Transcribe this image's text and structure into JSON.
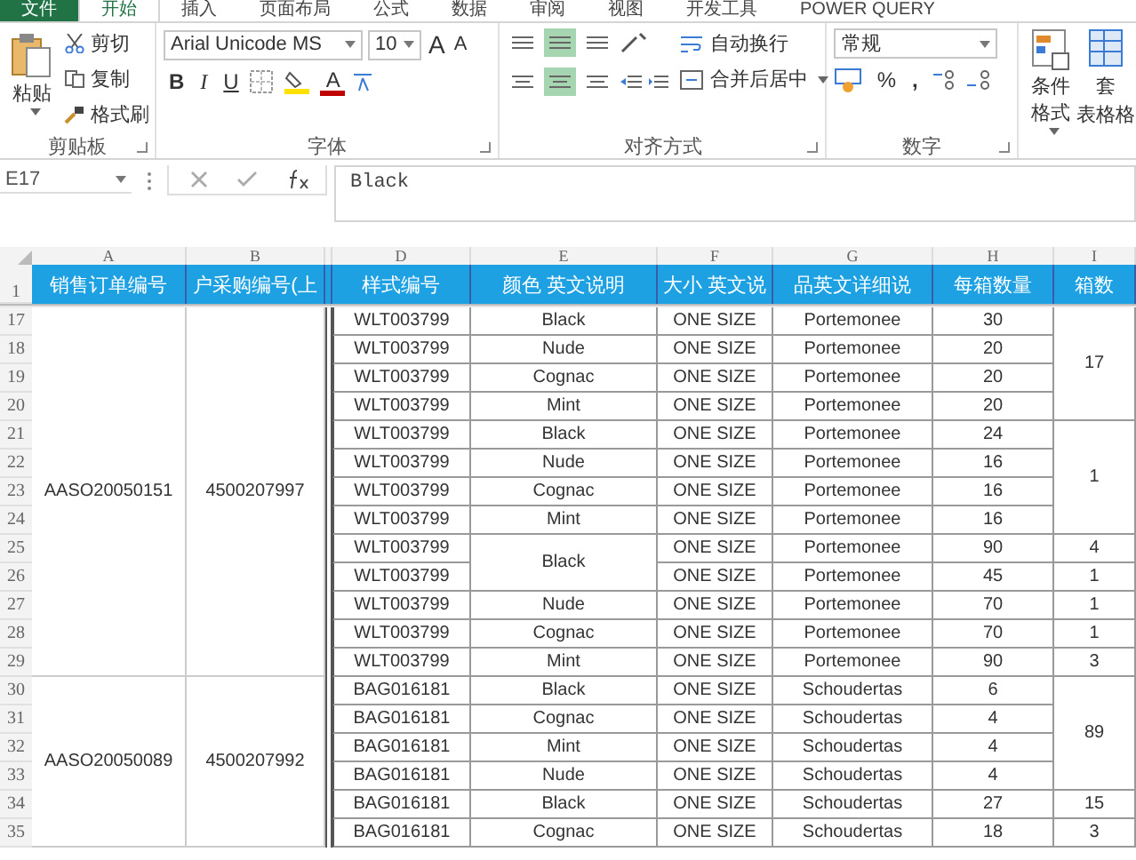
{
  "tabs": [
    {
      "label": "文件",
      "kind": "file",
      "selected": false
    },
    {
      "label": "开始",
      "kind": "tab",
      "selected": true
    },
    {
      "label": "插入",
      "kind": "tab",
      "selected": false
    },
    {
      "label": "页面布局",
      "kind": "tab",
      "selected": false
    },
    {
      "label": "公式",
      "kind": "tab",
      "selected": false
    },
    {
      "label": "数据",
      "kind": "tab",
      "selected": false
    },
    {
      "label": "审阅",
      "kind": "tab",
      "selected": false
    },
    {
      "label": "视图",
      "kind": "tab",
      "selected": false
    },
    {
      "label": "开发工具",
      "kind": "tab",
      "selected": false
    },
    {
      "label": "POWER QUERY",
      "kind": "tab",
      "selected": false
    }
  ],
  "ribbon": {
    "clipboard": {
      "label": "剪贴板",
      "paste": "粘贴",
      "cut": "剪切",
      "copy": "复制",
      "format_painter": "格式刷"
    },
    "font": {
      "label": "字体",
      "font_name": "Arial Unicode MS",
      "font_size": "10",
      "grow": "A",
      "shrink": "A",
      "bold": "B",
      "italic": "I",
      "underline": "U",
      "font_color": "A"
    },
    "alignment": {
      "label": "对齐方式",
      "vertical_align": [
        {
          "selected": false
        },
        {
          "selected": true
        },
        {
          "selected": false
        }
      ],
      "horizontal_align": [
        {
          "selected": false
        },
        {
          "selected": true
        },
        {
          "selected": false
        }
      ],
      "wrap": "自动换行",
      "merge": "合并后居中"
    },
    "number": {
      "label": "数字",
      "format": "常规",
      "percent": "%",
      "comma": ","
    },
    "styles": {
      "conditional": "条件格式",
      "table_format_top": "套",
      "table_format_bottom": "表格格"
    }
  },
  "formula_bar": {
    "name_box": "E17",
    "formula": "Black"
  },
  "sheet": {
    "columns": [
      {
        "letter": "A",
        "header": "销售订单编号"
      },
      {
        "letter": "B",
        "header": "户采购编号(上"
      },
      {
        "letter": "D",
        "header": "样式编号"
      },
      {
        "letter": "E",
        "header": "颜色 英文说明"
      },
      {
        "letter": "F",
        "header": "大小 英文说"
      },
      {
        "letter": "G",
        "header": "品英文详细说"
      },
      {
        "letter": "H",
        "header": "每箱数量"
      },
      {
        "letter": "I",
        "header": "箱数"
      }
    ],
    "header_row": "1",
    "order_groups": [
      {
        "sales_order": "AASO20050151",
        "purchase_no": "4500207997",
        "rows": [
          {
            "number": "17",
            "style_no": "WLT003799",
            "color_name": "Black",
            "size": "ONE SIZE",
            "product": "Portemonee",
            "per_box": "30",
            "boxes": "17"
          },
          {
            "number": "18",
            "style_no": "WLT003799",
            "color_name": "Nude",
            "size": "ONE SIZE",
            "product": "Portemonee",
            "per_box": "20"
          },
          {
            "number": "19",
            "style_no": "WLT003799",
            "color_name": "Cognac",
            "size": "ONE SIZE",
            "product": "Portemonee",
            "per_box": "20"
          },
          {
            "number": "20",
            "style_no": "WLT003799",
            "color_name": "Mint",
            "size": "ONE SIZE",
            "product": "Portemonee",
            "per_box": "20"
          },
          {
            "number": "21",
            "style_no": "WLT003799",
            "color_name": "Black",
            "size": "ONE SIZE",
            "product": "Portemonee",
            "per_box": "24",
            "boxes": "1"
          },
          {
            "number": "22",
            "style_no": "WLT003799",
            "color_name": "Nude",
            "size": "ONE SIZE",
            "product": "Portemonee",
            "per_box": "16"
          },
          {
            "number": "23",
            "style_no": "WLT003799",
            "color_name": "Cognac",
            "size": "ONE SIZE",
            "product": "Portemonee",
            "per_box": "16"
          },
          {
            "number": "24",
            "style_no": "WLT003799",
            "color_name": "Mint",
            "size": "ONE SIZE",
            "product": "Portemonee",
            "per_box": "16"
          },
          {
            "number": "25",
            "style_no": "WLT003799",
            "color_name": "Black",
            "size": "ONE SIZE",
            "product": "Portemonee",
            "per_box": "90",
            "boxes": "4"
          },
          {
            "number": "26",
            "style_no": "WLT003799",
            "size": "ONE SIZE",
            "product": "Portemonee",
            "per_box": "45",
            "boxes": "1"
          },
          {
            "number": "27",
            "style_no": "WLT003799",
            "color_name": "Nude",
            "size": "ONE SIZE",
            "product": "Portemonee",
            "per_box": "70",
            "boxes": "1"
          },
          {
            "number": "28",
            "style_no": "WLT003799",
            "color_name": "Cognac",
            "size": "ONE SIZE",
            "product": "Portemonee",
            "per_box": "70",
            "boxes": "1"
          },
          {
            "number": "29",
            "style_no": "WLT003799",
            "color_name": "Mint",
            "size": "ONE SIZE",
            "product": "Portemonee",
            "per_box": "90",
            "boxes": "3"
          }
        ]
      },
      {
        "sales_order": "AASO20050089",
        "purchase_no": "4500207992",
        "rows": [
          {
            "number": "30",
            "style_no": "BAG016181",
            "color_name": "Black",
            "size": "ONE SIZE",
            "product": "Schoudertas",
            "per_box": "6",
            "boxes": "89"
          },
          {
            "number": "31",
            "style_no": "BAG016181",
            "color_name": "Cognac",
            "size": "ONE SIZE",
            "product": "Schoudertas",
            "per_box": "4"
          },
          {
            "number": "32",
            "style_no": "BAG016181",
            "color_name": "Mint",
            "size": "ONE SIZE",
            "product": "Schoudertas",
            "per_box": "4"
          },
          {
            "number": "33",
            "style_no": "BAG016181",
            "color_name": "Nude",
            "size": "ONE SIZE",
            "product": "Schoudertas",
            "per_box": "4"
          },
          {
            "number": "34",
            "style_no": "BAG016181",
            "color_name": "Black",
            "size": "ONE SIZE",
            "product": "Schoudertas",
            "per_box": "27",
            "boxes": "15"
          },
          {
            "number": "35",
            "style_no": "BAG016181",
            "color_name": "Cognac",
            "size": "ONE SIZE",
            "product": "Schoudertas",
            "per_box": "18",
            "boxes": "3"
          }
        ]
      }
    ]
  }
}
